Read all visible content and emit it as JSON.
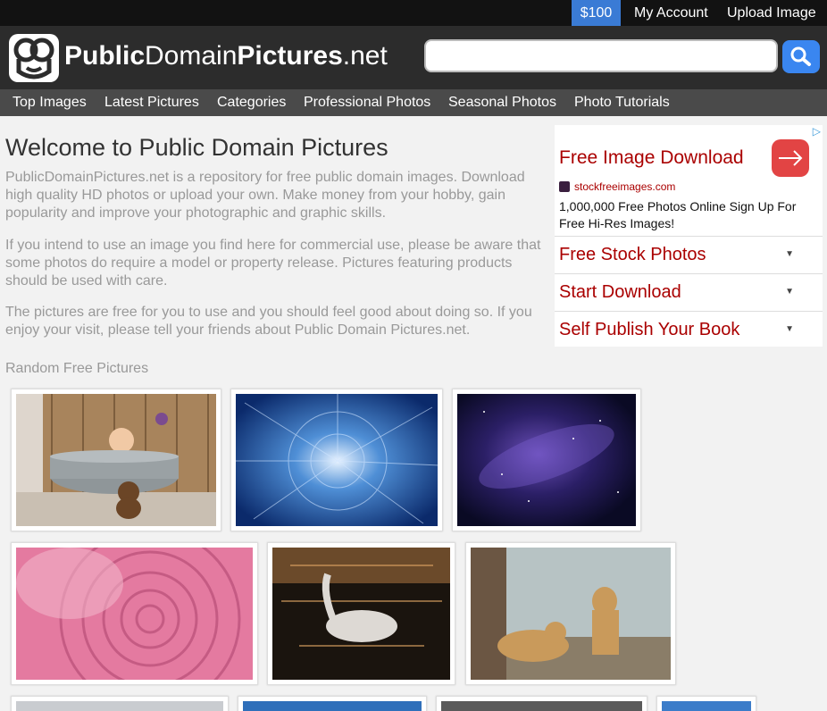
{
  "topbar": {
    "money": "$100",
    "account": "My Account",
    "upload": "Upload Image"
  },
  "header": {
    "logo_bold1": "Public",
    "logo_normal1": "Domain",
    "logo_bold2": "Pictures",
    "logo_normal2": ".net",
    "search_value": ""
  },
  "nav": {
    "items": [
      "Top Images",
      "Latest Pictures",
      "Categories",
      "Professional Photos",
      "Seasonal Photos",
      "Photo Tutorials"
    ]
  },
  "main": {
    "title": "Welcome to Public Domain Pictures",
    "paragraphs": [
      "PublicDomainPictures.net is a repository for free public domain images. Download high quality HD photos or upload your own. Make money from your hobby, gain popularity and improve your photographic and graphic skills.",
      "If you intend to use an image you find here for commercial use, please be aware that some photos do require a model or property release. Pictures featuring products should be used with care.",
      "The pictures are free for you to use and you should feel good about doing so. If you enjoy your visit, please tell your friends about Public Domain Pictures.net."
    ],
    "random_title": "Random Free Pictures"
  },
  "ad": {
    "title": "Free Image Download",
    "site": "stockfreeimages.com",
    "description": "1,000,000 Free Photos Online Sign Up For Free Hi-Res Images!",
    "rows": [
      "Free Stock Photos",
      "Start Download",
      "Self Publish Your Book"
    ],
    "accent_color": "#aa0000"
  },
  "thumbnails": [
    {
      "subject": "baby in metal tub with teddy bear"
    },
    {
      "subject": "blue crystal abstract"
    },
    {
      "subject": "purple galaxy space"
    },
    {
      "subject": "pink rose close-up"
    },
    {
      "subject": "swan on sunset water"
    },
    {
      "subject": "two lionesses with tree"
    }
  ],
  "colors": {
    "topbar_bg": "#121212",
    "header_bg": "#2c2c2c",
    "nav_bg": "#4a4a4a",
    "money_bg": "#3a7bd5",
    "search_button": "#3a86f0"
  }
}
